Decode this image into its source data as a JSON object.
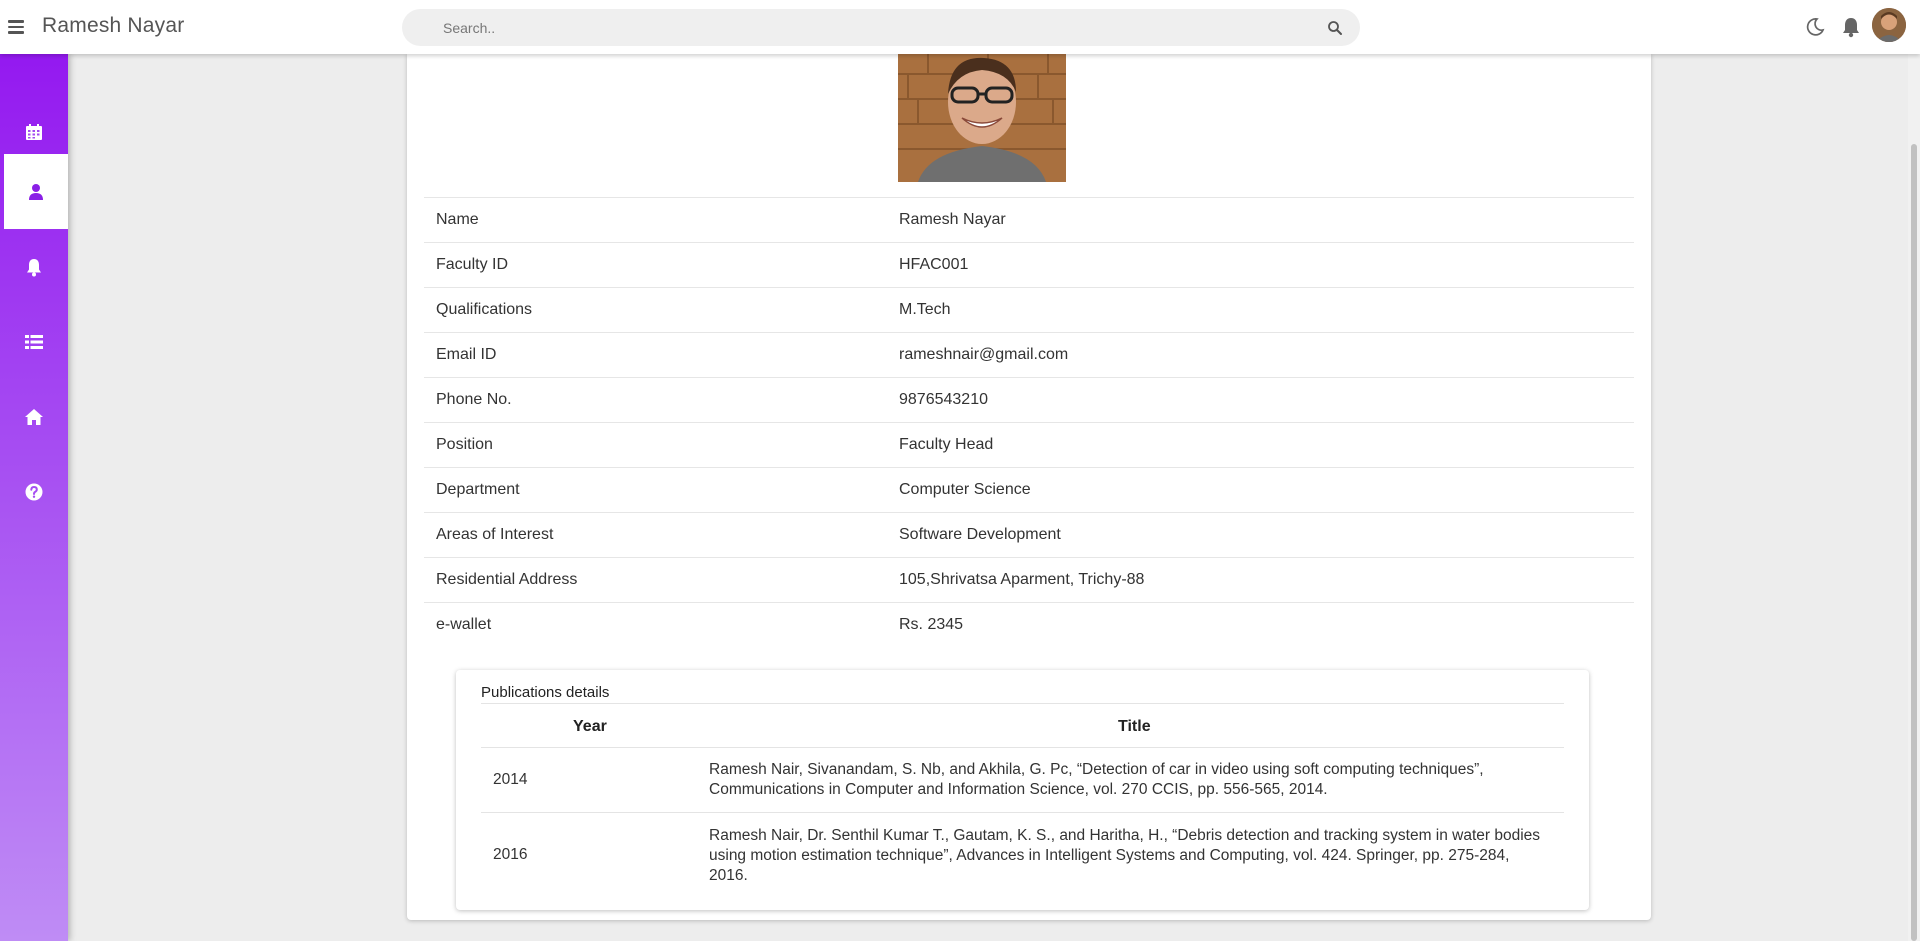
{
  "header": {
    "title": "Ramesh Nayar",
    "search_placeholder": "Search.."
  },
  "sidebar": {
    "items": [
      {
        "icon": "calendar-icon",
        "active": false
      },
      {
        "icon": "user-icon",
        "active": true
      },
      {
        "icon": "bell-icon",
        "active": false
      },
      {
        "icon": "list-icon",
        "active": false
      },
      {
        "icon": "home-icon",
        "active": false
      },
      {
        "icon": "help-icon",
        "active": false
      }
    ]
  },
  "profile": {
    "rows": [
      {
        "label": "Name",
        "value": "Ramesh Nayar"
      },
      {
        "label": "Faculty ID",
        "value": "HFAC001"
      },
      {
        "label": "Qualifications",
        "value": "M.Tech"
      },
      {
        "label": "Email ID",
        "value": "rameshnair@gmail.com"
      },
      {
        "label": "Phone No.",
        "value": "9876543210"
      },
      {
        "label": "Position",
        "value": "Faculty Head"
      },
      {
        "label": "Department",
        "value": "Computer Science"
      },
      {
        "label": "Areas of Interest",
        "value": "Software Development"
      },
      {
        "label": "Residential Address",
        "value": "105,Shrivatsa Aparment, Trichy-88"
      },
      {
        "label": "e-wallet",
        "value": "Rs. 2345"
      }
    ]
  },
  "publications": {
    "title": "Publications details",
    "columns": {
      "year": "Year",
      "title": "Title"
    },
    "rows": [
      {
        "year": "2014",
        "title": "Ramesh Nair, Sivanandam, S. Nb, and Akhila, G. Pc, “Detection of car in video using soft computing techniques”, Communications in Computer and Information Science, vol. 270 CCIS, pp. 556-565, 2014."
      },
      {
        "year": "2016",
        "title": "Ramesh Nair, Dr. Senthil Kumar T., Gautam, K. S., and Haritha, H., “Debris detection and tracking system in water bodies using motion estimation technique”, Advances in Intelligent Systems and Computing, vol. 424. Springer, pp. 275-284, 2016."
      }
    ]
  },
  "colors": {
    "sidebar_top": "#9419f0",
    "sidebar_bottom": "#bf8cf5",
    "active_icon": "#8a1fe6"
  }
}
